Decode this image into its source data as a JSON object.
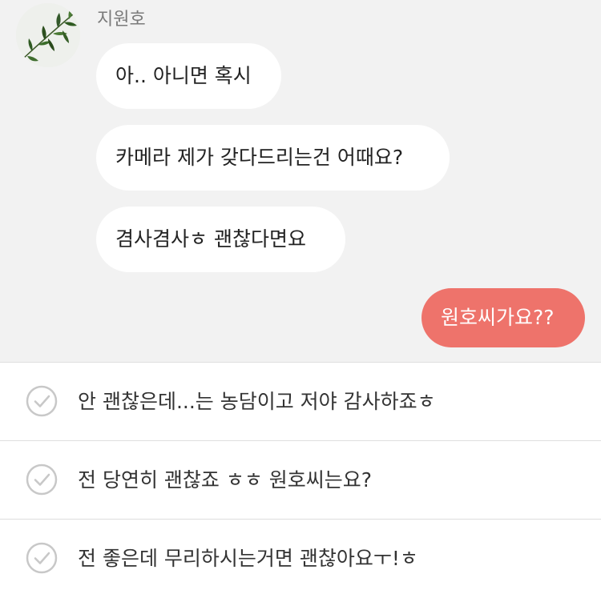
{
  "chat": {
    "sender_name": "지원호",
    "avatar_icon": "leaf-avatar-icon",
    "incoming_messages": [
      "아.. 아니면 혹시",
      "카메라 제가 갖다드리는건 어때요?",
      "겸사겸사ㅎ 괜찮다면요"
    ],
    "outgoing_messages": [
      "원호씨가요??"
    ],
    "colors": {
      "background": "#f2f2f2",
      "incoming_bubble": "#ffffff",
      "outgoing_bubble": "#ee736b"
    }
  },
  "choices": [
    {
      "text": "안 괜찮은데...는 농담이고 저야 감사하죠ㅎ",
      "icon": "check-circle-icon"
    },
    {
      "text": "전 당연히 괜찮죠 ㅎㅎ 원호씨는요?",
      "icon": "check-circle-icon"
    },
    {
      "text": "전 좋은데 무리하시는거면 괜찮아요ㅜ!ㅎ",
      "icon": "check-circle-icon"
    }
  ]
}
